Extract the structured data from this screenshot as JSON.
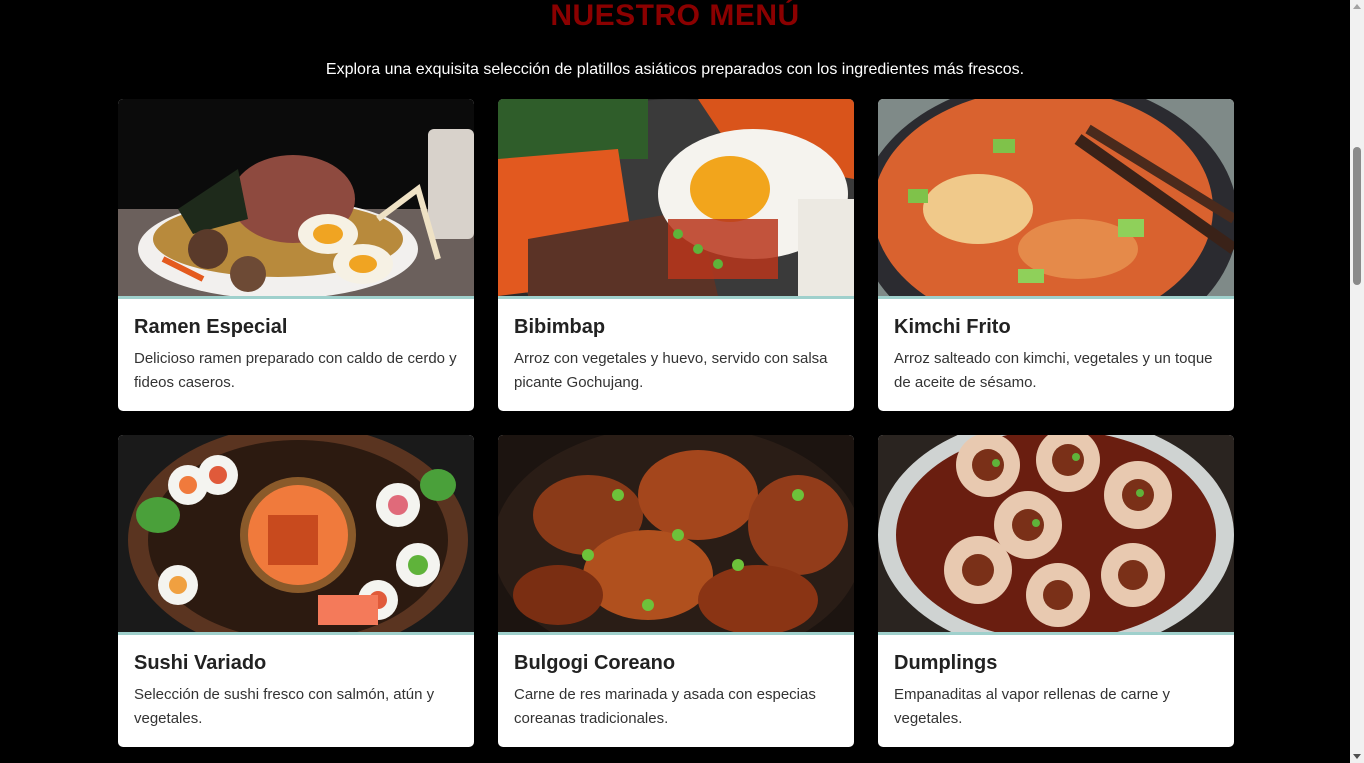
{
  "header": {
    "title": "NUESTRO MENÚ",
    "subtitle": "Explora una exquisita selección de platillos asiáticos preparados con los ingredientes más frescos."
  },
  "menu": {
    "items": [
      {
        "name": "Ramen Especial",
        "description": "Delicioso ramen preparado con caldo de cerdo y fideos caseros.",
        "image": "ramen-bowl-image"
      },
      {
        "name": "Bibimbap",
        "description": "Arroz con vegetales y huevo, servido con salsa picante Gochujang.",
        "image": "bibimbap-image"
      },
      {
        "name": "Kimchi Frito",
        "description": "Arroz salteado con kimchi, vegetales y un toque de aceite de sésamo.",
        "image": "kimchi-fried-rice-image"
      },
      {
        "name": "Sushi Variado",
        "description": "Selección de sushi fresco con salmón, atún y vegetales.",
        "image": "sushi-platter-image"
      },
      {
        "name": "Bulgogi Coreano",
        "description": "Carne de res marinada y asada con especias coreanas tradicionales.",
        "image": "bulgogi-image"
      },
      {
        "name": "Dumplings",
        "description": "Empanaditas al vapor rellenas de carne y vegetales.",
        "image": "dumplings-image"
      }
    ]
  },
  "colors": {
    "background": "#000000",
    "title": "#8b0000",
    "card": "#ffffff",
    "image_border": "#9fd0cc"
  }
}
